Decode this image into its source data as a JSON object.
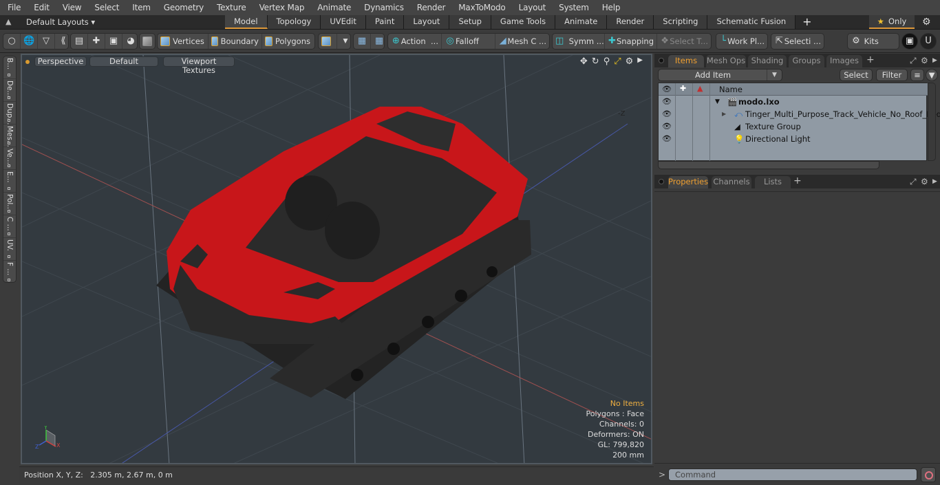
{
  "menu": [
    "File",
    "Edit",
    "View",
    "Select",
    "Item",
    "Geometry",
    "Texture",
    "Vertex Map",
    "Animate",
    "Dynamics",
    "Render",
    "MaxToModo",
    "Layout",
    "System",
    "Help"
  ],
  "layoutbar": {
    "layouts_label": "Default Layouts",
    "tabs": [
      "Model",
      "Topology",
      "UVEdit",
      "Paint",
      "Layout",
      "Setup",
      "Game Tools",
      "Animate",
      "Render",
      "Scripting",
      "Schematic Fusion"
    ],
    "active_tab": "Model",
    "add_tab": "+",
    "only_label": "Only"
  },
  "toolbar": {
    "vertices": "Vertices",
    "boundary": "Boundary",
    "polygons": "Polygons",
    "action": "Action",
    "action_more": "...",
    "falloff": "Falloff",
    "mesh_c": "Mesh C ...",
    "symm": "Symm ...",
    "snapping": "Snapping",
    "select_t": "Select T...",
    "work_pl": "Work Pl...",
    "selecti": "Selecti ...",
    "kits": "Kits"
  },
  "left_strip": [
    "B...",
    "De...",
    "Dup...",
    "Mes...",
    "Ve...",
    "E...",
    "Pol...",
    "C ...",
    "UV.",
    "F ..."
  ],
  "viewport": {
    "view_mode": "Perspective",
    "shading": "Default",
    "textures": "Viewport Textures",
    "neg_z_label": "-Z",
    "hud": {
      "no_items": "No Items",
      "polygons": "Polygons : Face",
      "channels": "Channels: 0",
      "deformers": "Deformers: ON",
      "gl": "GL: 799,820",
      "grid": "200 mm"
    },
    "axes": {
      "x": "X",
      "y": "Y",
      "z": "Z"
    }
  },
  "status": {
    "position": "Position X, Y, Z:   2.305 m, 2.67 m, 0 m"
  },
  "items_panel": {
    "tabs": [
      "Items",
      "Mesh Ops",
      "Shading",
      "Groups",
      "Images"
    ],
    "active_tab": "Items",
    "add_item": "Add Item",
    "select": "Select",
    "filter": "Filter",
    "column_name": "Name",
    "rows": [
      {
        "name": "modo.lxo",
        "bold": true
      },
      {
        "name": "Tinger_Multi_Purpose_Track_Vehicle_No_Roof_Red_..."
      },
      {
        "name": "Texture Group"
      },
      {
        "name": "Directional Light"
      }
    ]
  },
  "props_panel": {
    "tabs": [
      "Properties",
      "Channels",
      "Lists"
    ],
    "active_tab": "Properties"
  },
  "command": {
    "prompt": ">",
    "placeholder": "Command"
  },
  "colors": {
    "accent": "#e09a3a",
    "vehicle_red": "#c8161a",
    "viewport_bg": "#333a40"
  }
}
